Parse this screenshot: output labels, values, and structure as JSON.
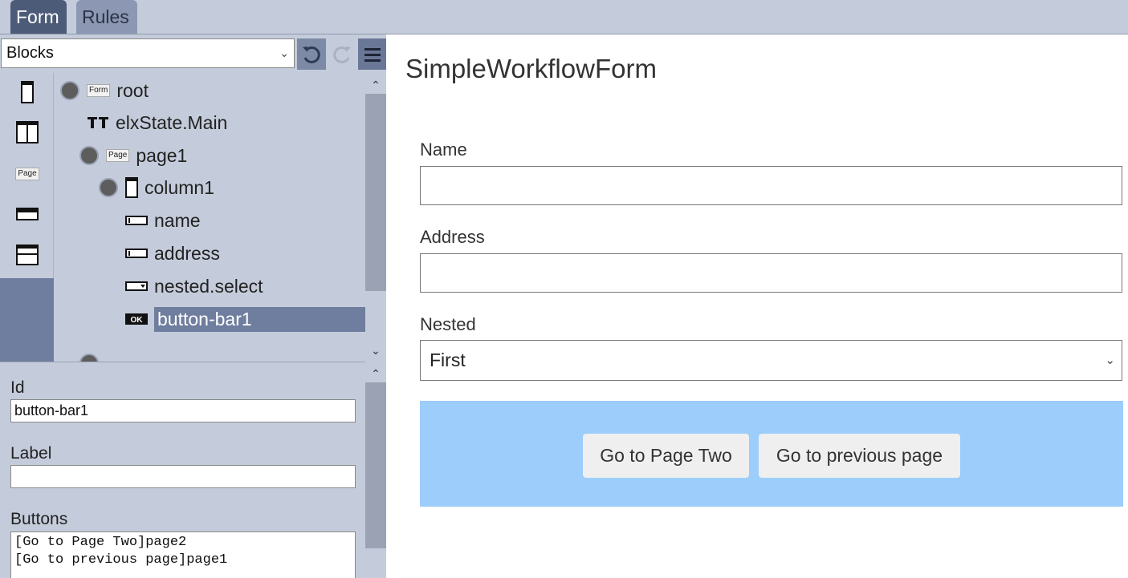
{
  "tabs": [
    {
      "label": "Form",
      "active": true
    },
    {
      "label": "Rules",
      "active": false
    }
  ],
  "toolbar": {
    "select_value": "Blocks",
    "undo_icon": "undo-icon",
    "redo_icon": "redo-icon",
    "menu_icon": "hamburger-menu-icon"
  },
  "palette": {
    "items": [
      {
        "icon": "column-icon"
      },
      {
        "icon": "two-columns-icon"
      },
      {
        "icon": "page-icon",
        "label": "Page"
      },
      {
        "icon": "field-bar-icon"
      },
      {
        "icon": "header-row-icon"
      }
    ]
  },
  "tree": {
    "nodes": [
      {
        "label": "root",
        "badge": "Form"
      },
      {
        "label": "elxState.Main"
      },
      {
        "label": "page1",
        "badge": "Page"
      },
      {
        "label": "column1"
      },
      {
        "label": "name"
      },
      {
        "label": "address"
      },
      {
        "label": "nested.select"
      },
      {
        "label": "button-bar1",
        "badge": "OK",
        "selected": true
      }
    ]
  },
  "props": {
    "id_label": "Id",
    "id_value": "button-bar1",
    "label_label": "Label",
    "label_value": "",
    "buttons_label": "Buttons",
    "buttons_value": "[Go to Page Two]page2\n[Go to previous page]page1"
  },
  "form": {
    "title": "SimpleWorkflowForm",
    "name_label": "Name",
    "name_value": "",
    "address_label": "Address",
    "address_value": "",
    "nested_label": "Nested",
    "nested_selected": "First",
    "buttons": [
      "Go to Page Two",
      "Go to previous page"
    ]
  },
  "colors": {
    "panel": "#c4ccdb",
    "active_tab": "#4c5b78",
    "selection": "#6f7e9e",
    "button_bar": "#9ccdfb"
  }
}
